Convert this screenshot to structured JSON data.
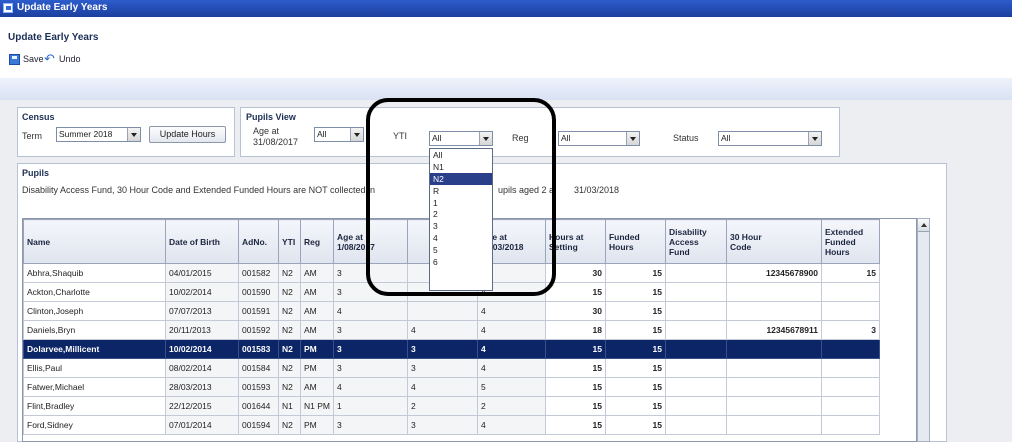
{
  "window": {
    "title": "Update Early Years"
  },
  "header": {
    "title": "Update Early Years",
    "save_label": "Save",
    "undo_label": "Undo"
  },
  "census": {
    "group_label": "Census",
    "term_label": "Term",
    "term_value": "Summer 2018",
    "update_button": "Update Hours"
  },
  "pupils_view": {
    "group_label": "Pupils View",
    "age_at_label_1": "Age at",
    "age_at_label_2": "31/08/2017",
    "age_value": "All",
    "yti_label": "YTI",
    "yti_value": "All",
    "reg_label": "Reg",
    "reg_value": "All",
    "status_label": "Status",
    "status_value": "All",
    "yti_options": [
      "All",
      "N1",
      "N2",
      "R",
      "1",
      "2",
      "3",
      "4",
      "5",
      "6"
    ],
    "yti_highlighted": "N2"
  },
  "pupils": {
    "group_label": "Pupils",
    "note_1": "Disability Access Fund, 30 Hour Code and Extended Funded Hours are NOT collected in",
    "note_2": "upils aged 2 a",
    "note_3": "31/03/2018",
    "columns": {
      "name": "Name",
      "dob": "Date of Birth",
      "adno": "AdNo.",
      "yti": "YTI",
      "reg": "Reg",
      "age1_a": "Age at",
      "age1_b": "1/08/2017",
      "blank": "",
      "age2_a": "Age at",
      "age2_b": "31/03/2018",
      "hours_setting_a": "Hours at",
      "hours_setting_b": "Setting",
      "funded_a": "Funded",
      "funded_b": "Hours",
      "daf_a": "Disability",
      "daf_b": "Access",
      "daf_c": "Fund",
      "code_a": "30 Hour",
      "code_b": "Code",
      "ext_a": "Extended",
      "ext_b": "Funded",
      "ext_c": "Hours"
    },
    "rows": [
      {
        "name": "Abhra,Shaquib",
        "dob": "04/01/2015",
        "adno": "001582",
        "yti": "N2",
        "reg": "AM",
        "age1": "3",
        "age2": "",
        "age3": "3",
        "hours": "30",
        "funded": "15",
        "daf": "",
        "code": "12345678900",
        "ext": "15"
      },
      {
        "name": "Ackton,Charlotte",
        "dob": "10/02/2014",
        "adno": "001590",
        "yti": "N2",
        "reg": "AM",
        "age1": "3",
        "age2": "",
        "age3": "4",
        "hours": "15",
        "funded": "15",
        "daf": "",
        "code": "",
        "ext": ""
      },
      {
        "name": "Clinton,Joseph",
        "dob": "07/07/2013",
        "adno": "001591",
        "yti": "N2",
        "reg": "AM",
        "age1": "4",
        "age2": "",
        "age3": "4",
        "hours": "30",
        "funded": "15",
        "daf": "",
        "code": "",
        "ext": ""
      },
      {
        "name": "Daniels,Bryn",
        "dob": "20/11/2013",
        "adno": "001592",
        "yti": "N2",
        "reg": "AM",
        "age1": "3",
        "age2": "4",
        "age3": "4",
        "hours": "18",
        "funded": "15",
        "daf": "",
        "code": "12345678911",
        "ext": "3"
      },
      {
        "name": "Dolarvee,Millicent",
        "dob": "10/02/2014",
        "adno": "001583",
        "yti": "N2",
        "reg": "PM",
        "age1": "3",
        "age2": "3",
        "age3": "4",
        "hours": "15",
        "funded": "15",
        "daf": "",
        "code": "",
        "ext": "",
        "selected": true
      },
      {
        "name": "Ellis,Paul",
        "dob": "08/02/2014",
        "adno": "001584",
        "yti": "N2",
        "reg": "PM",
        "age1": "3",
        "age2": "3",
        "age3": "4",
        "hours": "15",
        "funded": "15",
        "daf": "",
        "code": "",
        "ext": ""
      },
      {
        "name": "Fatwer,Michael",
        "dob": "28/03/2013",
        "adno": "001593",
        "yti": "N2",
        "reg": "AM",
        "age1": "4",
        "age2": "4",
        "age3": "5",
        "hours": "15",
        "funded": "15",
        "daf": "",
        "code": "",
        "ext": ""
      },
      {
        "name": "Flint,Bradley",
        "dob": "22/12/2015",
        "adno": "001644",
        "yti": "N1",
        "reg": "N1 PM",
        "age1": "1",
        "age2": "2",
        "age3": "2",
        "hours": "15",
        "funded": "15",
        "daf": "",
        "code": "",
        "ext": ""
      },
      {
        "name": "Ford,Sidney",
        "dob": "07/01/2014",
        "adno": "001594",
        "yti": "N2",
        "reg": "PM",
        "age1": "3",
        "age2": "3",
        "age3": "4",
        "hours": "15",
        "funded": "15",
        "daf": "",
        "code": "",
        "ext": ""
      }
    ]
  }
}
